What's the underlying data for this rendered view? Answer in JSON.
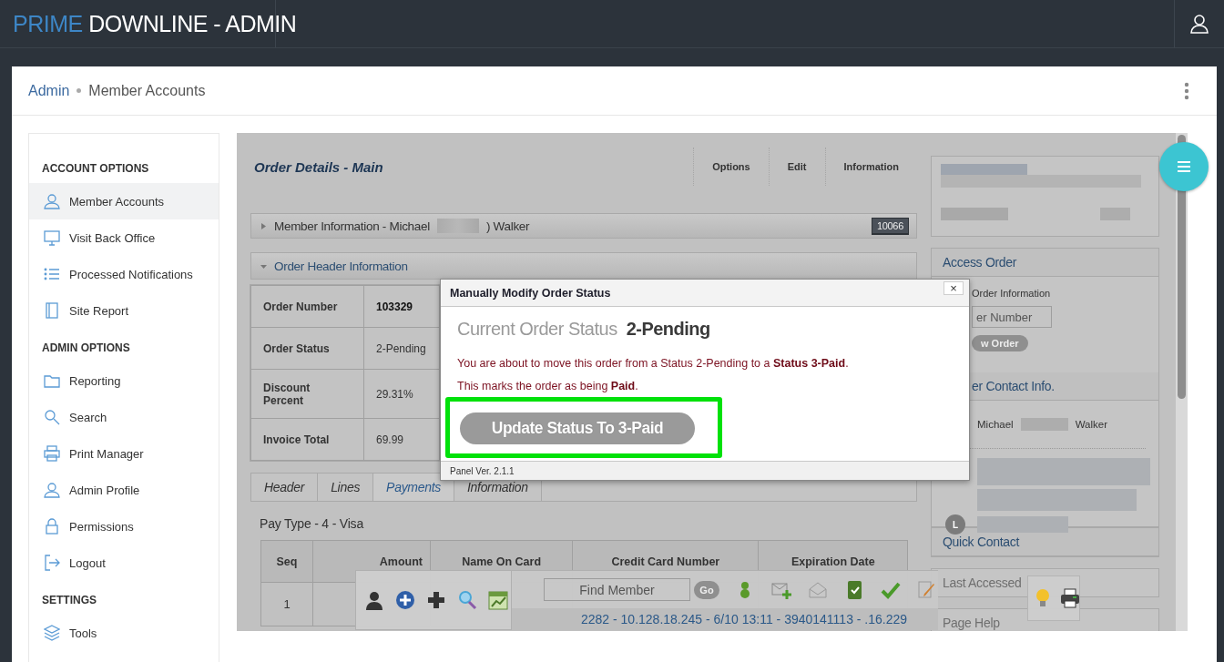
{
  "app_bar": {
    "brand_accent": "PRIME",
    "brand_rest": "DOWNLINE - ADMIN"
  },
  "breadcrumb": [
    {
      "label": "Admin",
      "kind": "link"
    },
    {
      "label": "Member Accounts",
      "kind": "current"
    }
  ],
  "sidebar": {
    "sections": [
      {
        "heading": "ACCOUNT OPTIONS",
        "items": [
          {
            "label": "Member Accounts",
            "selected": true
          },
          {
            "label": "Visit Back Office",
            "selected": false
          },
          {
            "label": "Processed Notifications",
            "selected": false
          },
          {
            "label": "Site Report",
            "selected": false
          }
        ]
      },
      {
        "heading": "ADMIN OPTIONS",
        "items": [
          {
            "label": "Reporting",
            "selected": false
          },
          {
            "label": "Search",
            "selected": false
          },
          {
            "label": "Print Manager",
            "selected": false
          },
          {
            "label": "Admin Profile",
            "selected": false
          },
          {
            "label": "Permissions",
            "selected": false
          },
          {
            "label": "Logout",
            "selected": false
          }
        ]
      },
      {
        "heading": "SETTINGS",
        "items": [
          {
            "label": "Tools",
            "selected": false
          }
        ]
      }
    ]
  },
  "order": {
    "title": "Order Details - Main",
    "header_tabs": [
      "Options",
      "Edit",
      "Information"
    ],
    "member_bar": {
      "label_start": "Member Information - Michael",
      "label_end": ") Walker",
      "expanded": false,
      "badge": "10066"
    },
    "header_bar": {
      "label": "Order Header Information",
      "expanded": true
    },
    "header_fields": [
      {
        "label": "Order Number",
        "value": "103329",
        "kind": "bold"
      },
      {
        "label": "Order Status",
        "value": "2-Pending",
        "kind": "plain"
      },
      {
        "label": "Discount Percent",
        "value": "29.31%",
        "kind": "plain"
      },
      {
        "label": "Invoice Total",
        "value": "69.99",
        "kind": "plain"
      }
    ],
    "tabs": [
      {
        "label": "Header",
        "selected": false
      },
      {
        "label": "Lines",
        "selected": false
      },
      {
        "label": "Payments",
        "selected": true
      },
      {
        "label": "Information",
        "selected": false
      }
    ],
    "pay_type": "Pay Type - 4 - Visa",
    "payments": {
      "columns": [
        "Seq",
        "Amount",
        "Name On Card",
        "Credit Card Number",
        "Expiration Date"
      ],
      "rows": [
        {
          "seq": "1"
        }
      ]
    }
  },
  "right_panel": {
    "access_order": {
      "title": "Access Order",
      "label": "Order Information",
      "placeholder": "er Number",
      "button": "w Order"
    },
    "contact": {
      "title": "er Contact Info.",
      "first_name": "Michael",
      "last_name": "Walker",
      "avatar_letter": "L"
    },
    "sections": [
      {
        "title": "Quick Contact",
        "faded": false
      },
      {
        "title": "Last Accessed",
        "faded": true
      },
      {
        "title": "Page Help",
        "faded": true
      }
    ]
  },
  "modal": {
    "title": "Manually Modify Order Status",
    "close": "×",
    "status_label": "Current Order Status",
    "status_value": "2-Pending",
    "messages": [
      "You are about to move this order from a Status 2-Pending to a **Status 3-Paid**.",
      "This marks the order as being **Paid**."
    ],
    "button": {
      "label": "Update Status To 3-Paid",
      "highlighted": true
    },
    "footer": "Panel Ver. 2.1.1"
  },
  "toolbar": {
    "search_placeholder": "Find Member",
    "go": "Go",
    "connection": "2282 - 10.128.18.245 - 6/10 13:11 - 3940141113 - .16.229"
  }
}
